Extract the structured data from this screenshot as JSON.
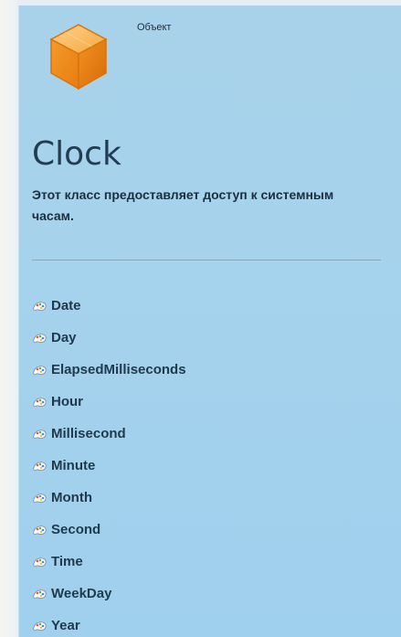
{
  "header": {
    "label": "Объект"
  },
  "object": {
    "icon": "orange-cube-icon",
    "title": "Clock",
    "description": "Этот класс предоставляет доступ к системным часам."
  },
  "properties": [
    {
      "label": "Date",
      "icon": "property-icon"
    },
    {
      "label": "Day",
      "icon": "property-icon"
    },
    {
      "label": "ElapsedMilliseconds",
      "icon": "property-icon"
    },
    {
      "label": "Hour",
      "icon": "property-icon"
    },
    {
      "label": "Millisecond",
      "icon": "property-icon"
    },
    {
      "label": "Minute",
      "icon": "property-icon"
    },
    {
      "label": "Month",
      "icon": "property-icon"
    },
    {
      "label": "Second",
      "icon": "property-icon"
    },
    {
      "label": "Time",
      "icon": "property-icon"
    },
    {
      "label": "WeekDay",
      "icon": "property-icon"
    },
    {
      "label": "Year",
      "icon": "property-icon"
    }
  ],
  "colors": {
    "panel": "#a5d2ec",
    "cube": "#f39a2a",
    "text": "#1b2f3d"
  }
}
